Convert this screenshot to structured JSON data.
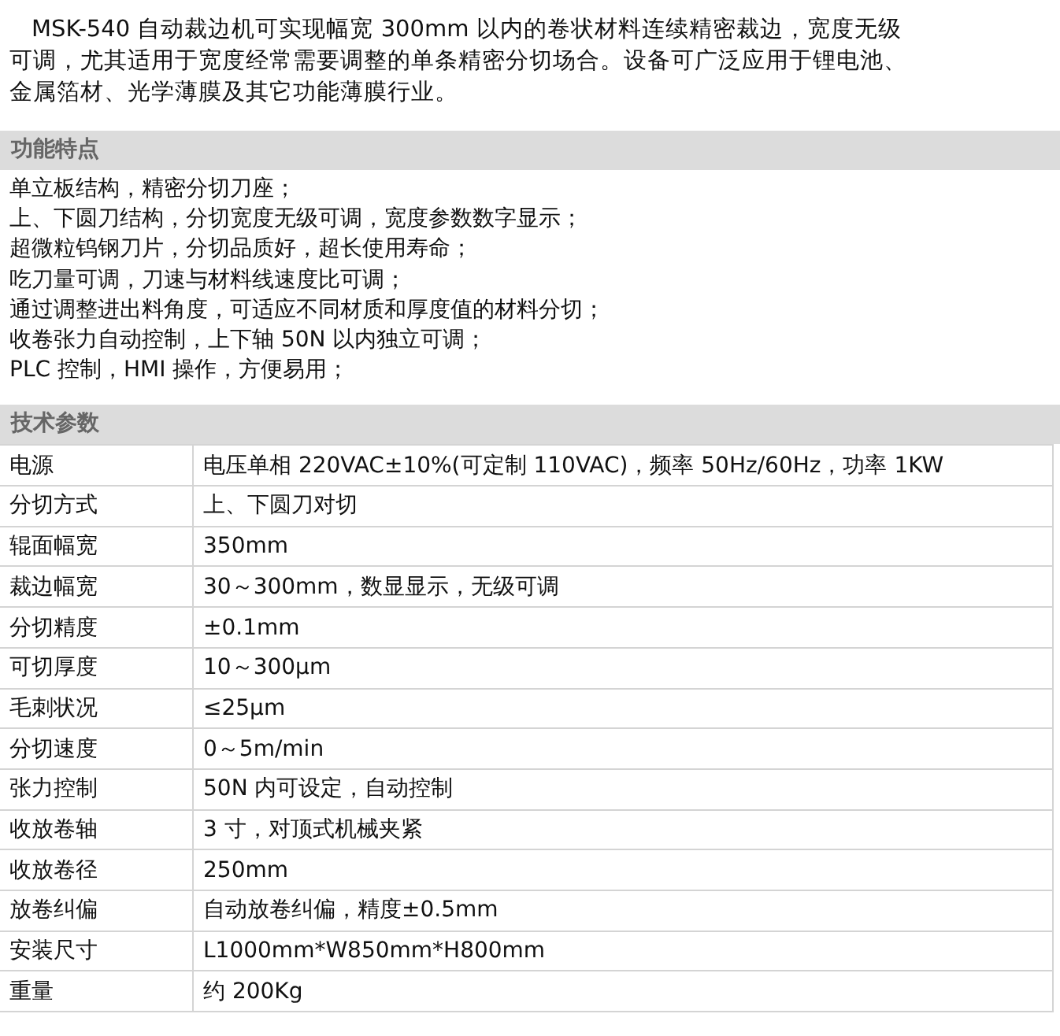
{
  "intro": "MSK-540 自动裁边机可实现幅宽 300mm 以内的卷状材料连续精密裁边，宽度无级可调，尤其适用于宽度经常需要调整的单条精密分切场合。设备可广泛应用于锂电池、金属箔材、光学薄膜及其它功能薄膜行业。",
  "features": {
    "heading": "功能特点",
    "items": [
      "单立板结构，精密分切刀座；",
      "上、下圆刀结构，分切宽度无级可调，宽度参数数字显示；",
      "超微粒钨钢刀片，分切品质好，超长使用寿命；",
      "吃刀量可调，刀速与材料线速度比可调；",
      "通过调整进出料角度，可适应不同材质和厚度值的材料分切；",
      "收卷张力自动控制，上下轴 50N 以内独立可调；",
      "PLC 控制，HMI 操作，方便易用；"
    ]
  },
  "specs": {
    "heading": "技术参数",
    "rows": [
      {
        "name": "电源",
        "value": "电压单相 220VAC±10%(可定制 110VAC)，频率 50Hz/60Hz，功率 1KW"
      },
      {
        "name": "分切方式",
        "value": "上、下圆刀对切"
      },
      {
        "name": "辊面幅宽",
        "value": "350mm"
      },
      {
        "name": "裁边幅宽",
        "value": "30～300mm，数显显示，无级可调"
      },
      {
        "name": "分切精度",
        "value": "±0.1mm"
      },
      {
        "name": "可切厚度",
        "value": "10～300μm"
      },
      {
        "name": "毛刺状况",
        "value": "≤25μm"
      },
      {
        "name": "分切速度",
        "value": "0～5m/min"
      },
      {
        "name": "张力控制",
        "value": "50N 内可设定，自动控制"
      },
      {
        "name": "收放卷轴",
        "value": "3 寸，对顶式机械夹紧"
      },
      {
        "name": "收放卷径",
        "value": "250mm"
      },
      {
        "name": "放卷纠偏",
        "value": "自动放卷纠偏，精度±0.5mm"
      },
      {
        "name": "安装尺寸",
        "value": "L1000mm*W850mm*H800mm"
      },
      {
        "name": "重量",
        "value": "约 200Kg"
      }
    ]
  }
}
